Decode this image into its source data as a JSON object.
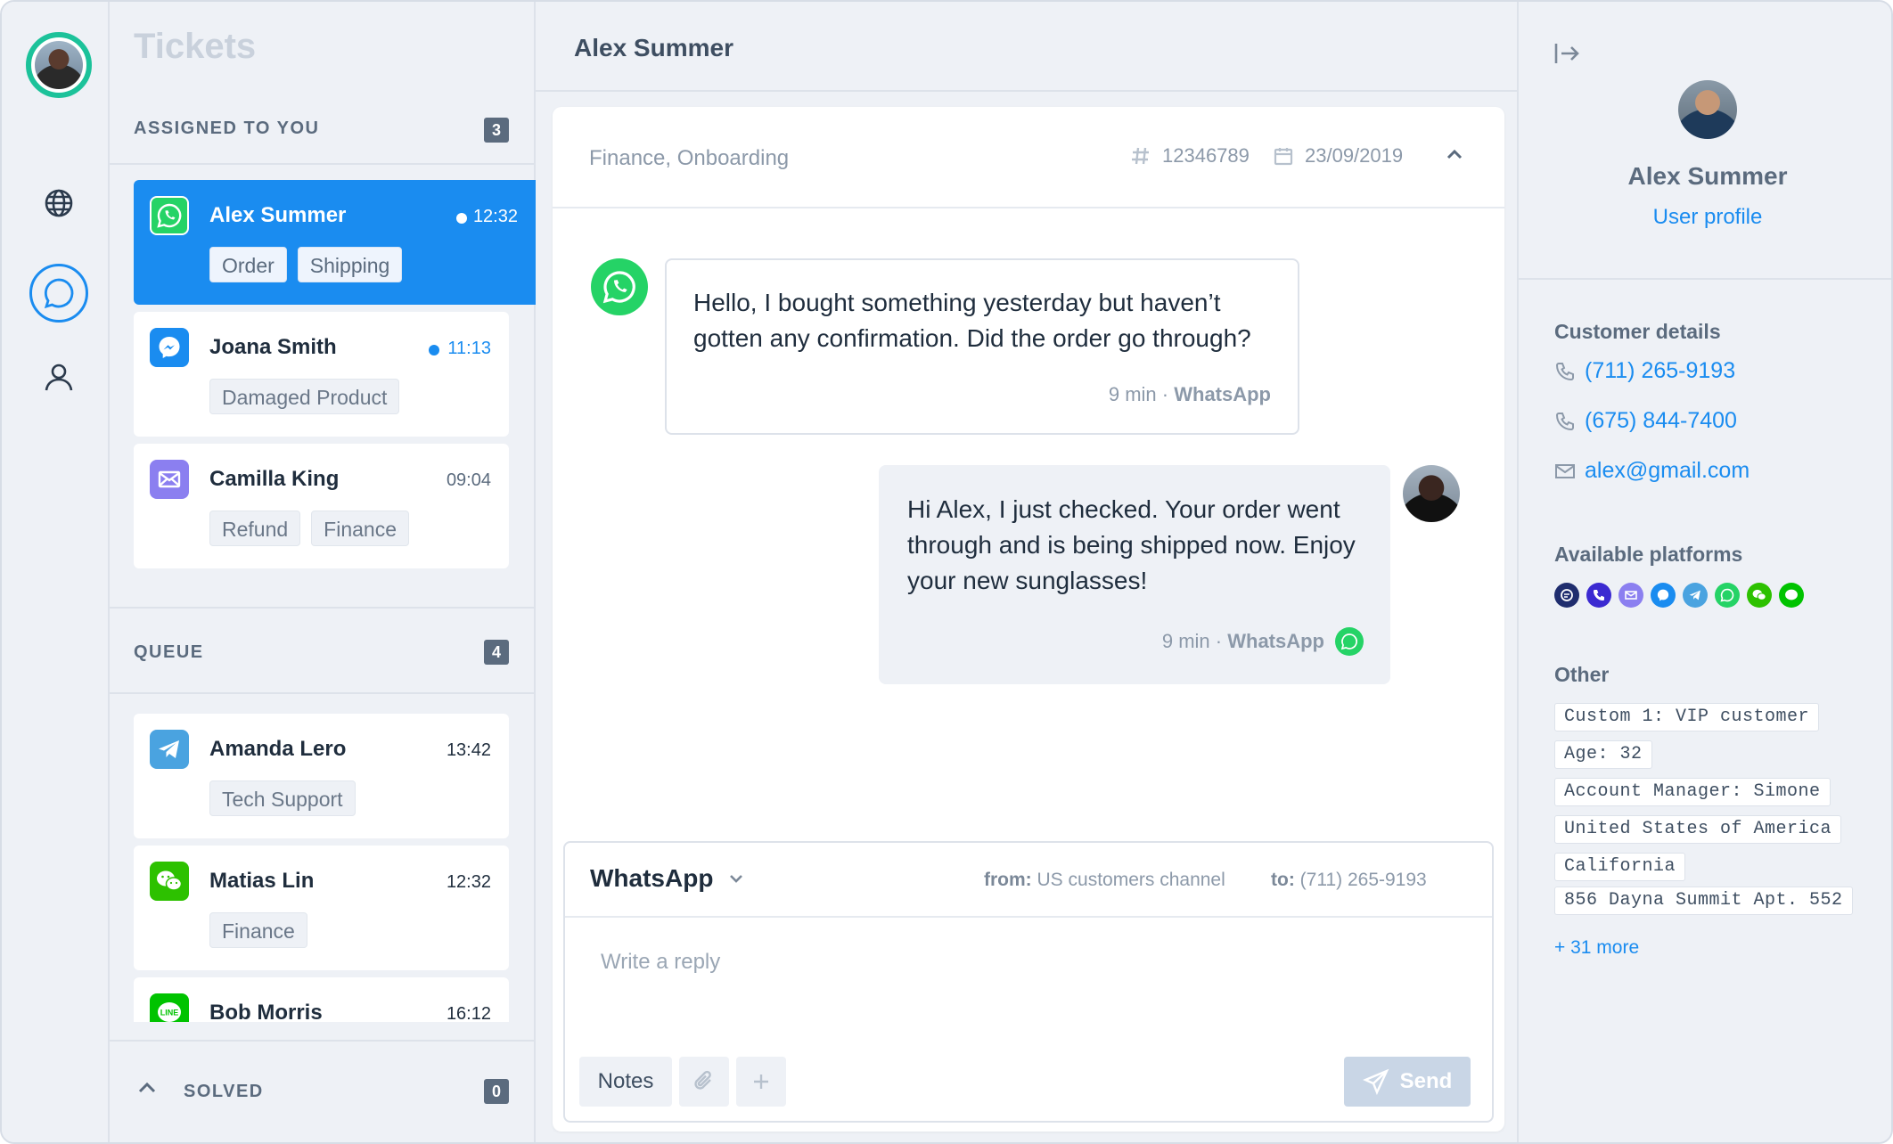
{
  "rail": {
    "avatar_alt": "current agent avatar",
    "nav": [
      "globe-icon",
      "chat-icon",
      "user-icon"
    ]
  },
  "tickets": {
    "title": "Tickets",
    "assigned": {
      "label": "ASSIGNED TO YOU",
      "count": "3",
      "items": [
        {
          "name": "Alex Summer",
          "time": "12:32",
          "channel": "whatsapp-icon",
          "tags": [
            "Order",
            "Shipping"
          ],
          "unread": true,
          "active": true
        },
        {
          "name": "Joana Smith",
          "time": "11:13",
          "channel": "messenger-icon",
          "tags": [
            "Damaged Product"
          ],
          "unread": true,
          "active": false
        },
        {
          "name": "Camilla King",
          "time": "09:04",
          "channel": "email-icon",
          "tags": [
            "Refund",
            "Finance"
          ],
          "unread": false,
          "active": false
        }
      ]
    },
    "queue": {
      "label": "QUEUE",
      "count": "4",
      "items": [
        {
          "name": "Amanda Lero",
          "time": "13:42",
          "channel": "telegram-icon",
          "tags": [
            "Tech Support"
          ]
        },
        {
          "name": "Matias Lin",
          "time": "12:32",
          "channel": "wechat-icon",
          "tags": [
            "Finance"
          ]
        },
        {
          "name": "Bob Morris",
          "time": "16:12",
          "channel": "line-icon",
          "tags": []
        }
      ]
    },
    "solved": {
      "label": "SOLVED",
      "count": "0"
    }
  },
  "conversation": {
    "header_name": "Alex Summer",
    "categories": "Finance, Onboarding",
    "ticket_id": "12346789",
    "date": "23/09/2019",
    "messages": [
      {
        "direction": "in",
        "text": "Hello, I bought something yesterday but haven’t gotten any confirmation. Did the order go through?",
        "ago": "9 min",
        "channel": "WhatsApp"
      },
      {
        "direction": "out",
        "text": "Hi Alex, I just checked. Your order went through and is being shipped now. Enjoy your new sunglasses!",
        "ago": "9 min",
        "channel": "WhatsApp"
      }
    ],
    "composer": {
      "channel": "WhatsApp",
      "from_label": "from:",
      "from_value": "US customers channel",
      "to_label": "to:",
      "to_value": "(711) 265-9193",
      "placeholder": "Write a reply",
      "notes_label": "Notes",
      "send_label": "Send"
    }
  },
  "profile": {
    "name": "Alex Summer",
    "link": "User profile",
    "details_title": "Customer details",
    "phones": [
      "(711) 265-9193",
      "(675) 844-7400"
    ],
    "email": "alex@gmail.com",
    "platforms_title": "Available platforms",
    "platforms": [
      {
        "icon": "chat-bubble-icon",
        "color": "#1f2d6e"
      },
      {
        "icon": "phone-icon",
        "color": "#3b2ad1"
      },
      {
        "icon": "email-icon",
        "color": "#8b7ff0"
      },
      {
        "icon": "messenger-icon",
        "color": "#1a8cf0"
      },
      {
        "icon": "telegram-icon",
        "color": "#4aa3e0"
      },
      {
        "icon": "whatsapp-icon",
        "color": "#25d366"
      },
      {
        "icon": "wechat-icon",
        "color": "#2dc100"
      },
      {
        "icon": "line-icon",
        "color": "#00c300"
      }
    ],
    "other_title": "Other",
    "other": [
      "Custom 1: VIP customer",
      "Age: 32",
      "Account Manager: Simone",
      "United States of America",
      "California",
      "856 Dayna Summit Apt. 552"
    ],
    "more": "+ 31 more"
  },
  "colors": {
    "accent": "#1a8cf0",
    "whatsapp": "#25d366",
    "online_ring": "#1cc29a"
  }
}
